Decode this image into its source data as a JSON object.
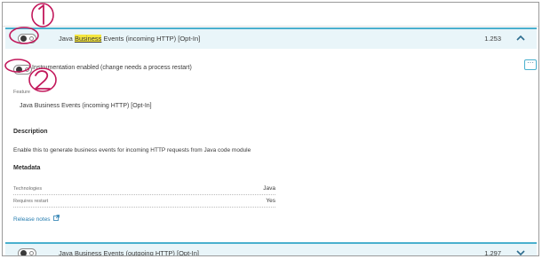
{
  "extensions": [
    {
      "title_prefix": "Java ",
      "title_highlight": "Business",
      "title_suffix": " Events (incoming HTTP) [Opt-In]",
      "version": "1.253",
      "expanded": true
    },
    {
      "title_prefix": "Java ",
      "title_highlight": "Business",
      "title_suffix": " Events (outgoing HTTP) [Opt-In]",
      "version": "1.297",
      "expanded": false
    }
  ],
  "detail": {
    "instrumentation_label": "Instrumentation enabled (change needs a process restart)",
    "more_label": "···",
    "feature_caption": "Feature",
    "feature_value": "Java Business Events (incoming HTTP) [Opt-In]",
    "description_heading": "Description",
    "description_text": "Enable this to generate business events for incoming HTTP requests from Java code module",
    "metadata_heading": "Metadata",
    "metadata": [
      {
        "key": "Technologies",
        "value": "Java"
      },
      {
        "key": "Requires restart",
        "value": "Yes"
      }
    ],
    "release_notes_label": "Release notes"
  },
  "icons": {
    "collapse": "chevron-up-icon",
    "expand": "chevron-down-icon",
    "more": "more-horizontal-icon",
    "external": "external-link-icon"
  },
  "colors": {
    "accent": "#4ab0ce",
    "row_background": "#e9f5f9",
    "highlight": "#f4e640",
    "link": "#2a7fb1",
    "annotation_ink": "#c2185b"
  },
  "annotations": [
    "1",
    "2"
  ]
}
